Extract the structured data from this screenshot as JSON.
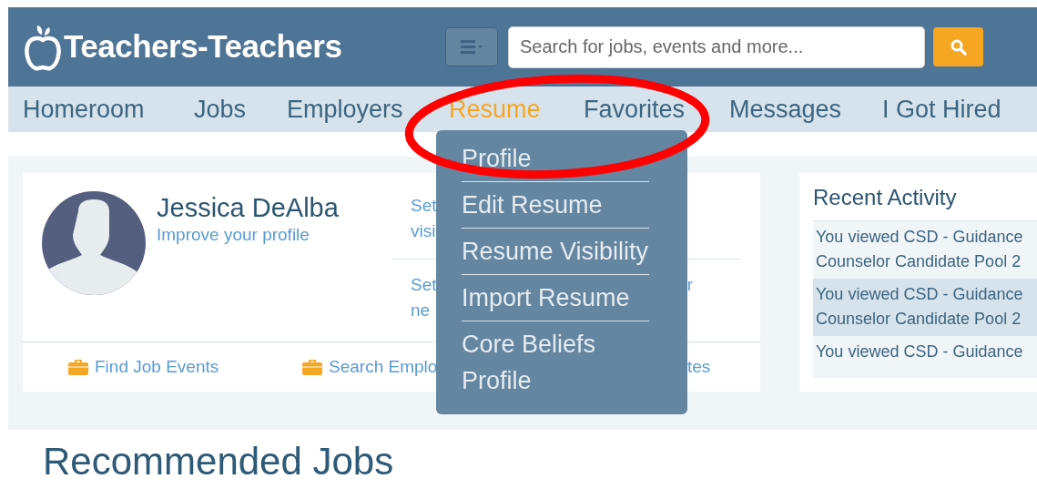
{
  "header": {
    "logo": "Teachers-Teachers",
    "search": {
      "placeholder": "Search for jobs, events and more..."
    }
  },
  "nav": [
    {
      "label": "Homeroom",
      "selected": false
    },
    {
      "label": "Jobs",
      "selected": false
    },
    {
      "label": "Employers",
      "selected": false
    },
    {
      "label": "Resume",
      "selected": true
    },
    {
      "label": "Favorites",
      "selected": false
    },
    {
      "label": "Messages",
      "selected": false
    },
    {
      "label": "I Got Hired",
      "selected": false
    }
  ],
  "dropdown": {
    "items": [
      "Profile",
      "Edit Resume",
      "Resume Visibility",
      "Import Resume",
      "Core Beliefs Profile"
    ]
  },
  "profile": {
    "name": "Jessica DeAlba",
    "link": "Improve your profile",
    "settings": [
      {
        "line_1": "Set",
        "line_2": "visi"
      },
      {
        "line_1": "Set",
        "line_1_end": "r",
        "line_2": "ne"
      }
    ],
    "quick_links": [
      {
        "label": "Find Job Events",
        "kind": "icon"
      },
      {
        "label": "Search Emplo",
        "kind": "icon"
      },
      {
        "label": "tes",
        "kind": "plain"
      }
    ]
  },
  "recent_activity": {
    "title": "Recent Activity",
    "items": [
      {
        "lines": [
          "You viewed CSD - Guidance",
          "Counselor Candidate Pool 2"
        ],
        "highlighted": false
      },
      {
        "lines": [
          "You viewed CSD - Guidance",
          "Counselor Candidate Pool 2"
        ],
        "highlighted": true
      },
      {
        "lines": [
          "You viewed CSD - Guidance"
        ],
        "highlighted": false
      }
    ]
  },
  "recommended": {
    "title": "Recommended Jobs"
  }
}
